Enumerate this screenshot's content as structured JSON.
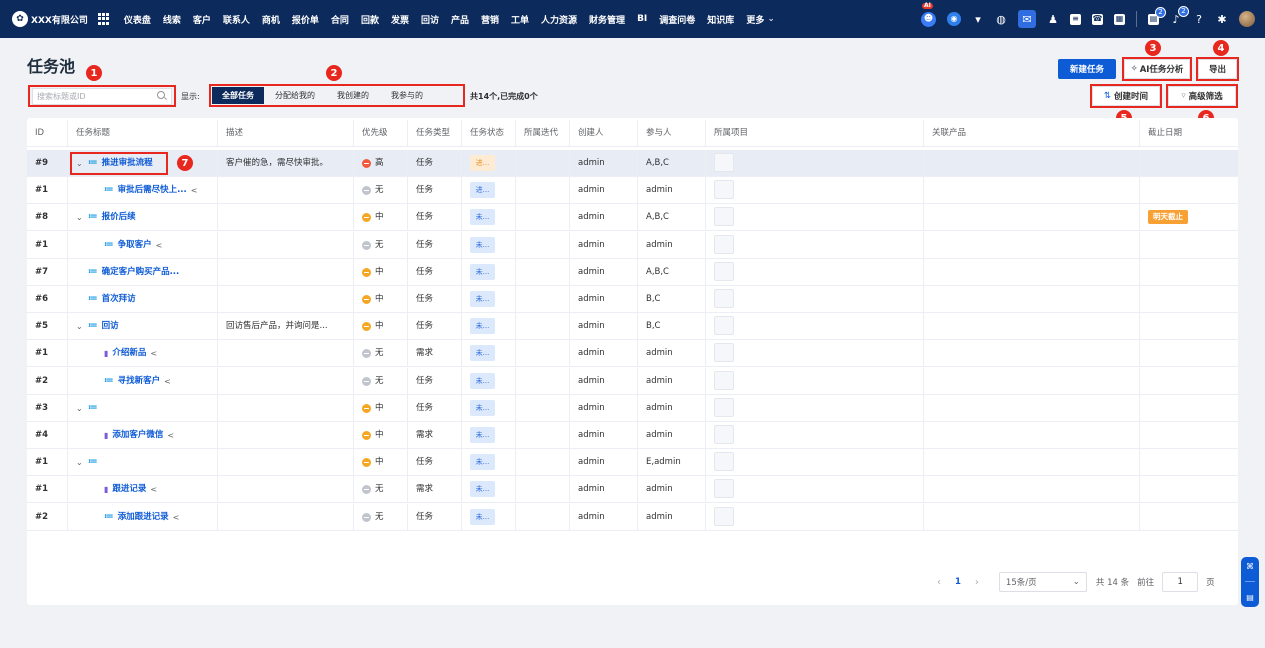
{
  "brand": {
    "name": "XXX有限公司"
  },
  "nav": [
    "仪表盘",
    "线索",
    "客户",
    "联系人",
    "商机",
    "报价单",
    "合同",
    "回款",
    "发票",
    "回访",
    "产品",
    "营销",
    "工单",
    "人力资源",
    "财务管理",
    "BI",
    "调查问卷",
    "知识库",
    "更多"
  ],
  "topbar_icons": {
    "ai_tag": "AI",
    "notify_badge_1": "2",
    "notify_badge_2": "2"
  },
  "page": {
    "title": "任务池"
  },
  "search": {
    "placeholder": "搜索标题或ID"
  },
  "filter": {
    "label": "显示:",
    "tabs": [
      "全部任务",
      "分配给我的",
      "我创建的",
      "我参与的"
    ],
    "active_index": 0,
    "summary": "共14个,已完成0个"
  },
  "actions": {
    "new_task": "新建任务",
    "ai_analysis": "AI任务分析",
    "export": "导出",
    "sort_created": "创建时间",
    "advanced_filter": "高级筛选"
  },
  "markers": [
    "1",
    "2",
    "3",
    "4",
    "5",
    "6",
    "7"
  ],
  "table": {
    "headers": [
      "ID",
      "任务标题",
      "描述",
      "优先级",
      "任务类型",
      "任务状态",
      "所属迭代",
      "创建人",
      "参与人",
      "所属项目",
      "关联产品",
      "截止日期"
    ],
    "rows": [
      {
        "id": "#9",
        "level": 0,
        "expand": true,
        "icon": "list",
        "title": "推进审批流程",
        "share": false,
        "desc": "客户催的急，需尽快审批。",
        "prio": "高",
        "prio_level": "high",
        "type": "任务",
        "status": "进...",
        "status_kind": "ing",
        "creator": "admin",
        "members": "A,B,C",
        "deadline": ""
      },
      {
        "id": "#1",
        "level": 1,
        "expand": false,
        "icon": "list",
        "title": "审批后需尽快上...",
        "share": true,
        "desc": "",
        "prio": "无",
        "prio_level": "none",
        "type": "任务",
        "status": "进...",
        "status_kind": "todo",
        "creator": "admin",
        "members": "admin",
        "deadline": ""
      },
      {
        "id": "#8",
        "level": 0,
        "expand": true,
        "icon": "list",
        "title": "报价后续",
        "share": false,
        "desc": "",
        "prio": "中",
        "prio_level": "mid",
        "type": "任务",
        "status": "未...",
        "status_kind": "todo",
        "creator": "admin",
        "members": "A,B,C",
        "deadline": "明天截止"
      },
      {
        "id": "#1",
        "level": 1,
        "expand": false,
        "icon": "list",
        "title": "争取客户",
        "share": true,
        "desc": "",
        "prio": "无",
        "prio_level": "none",
        "type": "任务",
        "status": "未...",
        "status_kind": "todo",
        "creator": "admin",
        "members": "admin",
        "deadline": ""
      },
      {
        "id": "#7",
        "level": 0,
        "expand": false,
        "icon": "list",
        "title": "确定客户购买产品...",
        "share": false,
        "desc": "",
        "prio": "中",
        "prio_level": "mid",
        "type": "任务",
        "status": "未...",
        "status_kind": "todo",
        "creator": "admin",
        "members": "A,B,C",
        "deadline": ""
      },
      {
        "id": "#6",
        "level": 0,
        "expand": false,
        "icon": "list",
        "title": "首次拜访",
        "share": false,
        "desc": "",
        "prio": "中",
        "prio_level": "mid",
        "type": "任务",
        "status": "未...",
        "status_kind": "todo",
        "creator": "admin",
        "members": "B,C",
        "deadline": ""
      },
      {
        "id": "#5",
        "level": 0,
        "expand": true,
        "icon": "list",
        "title": "回访",
        "share": false,
        "desc": "回访售后产品，并询问是...",
        "prio": "中",
        "prio_level": "mid",
        "type": "任务",
        "status": "未...",
        "status_kind": "todo",
        "creator": "admin",
        "members": "B,C",
        "deadline": ""
      },
      {
        "id": "#1",
        "level": 1,
        "expand": false,
        "icon": "flag",
        "title": "介绍新品",
        "share": true,
        "desc": "",
        "prio": "无",
        "prio_level": "none",
        "type": "需求",
        "status": "未...",
        "status_kind": "todo",
        "creator": "admin",
        "members": "admin",
        "deadline": ""
      },
      {
        "id": "#2",
        "level": 1,
        "expand": false,
        "icon": "list",
        "title": "寻找新客户",
        "share": true,
        "desc": "",
        "prio": "无",
        "prio_level": "none",
        "type": "任务",
        "status": "未...",
        "status_kind": "todo",
        "creator": "admin",
        "members": "admin",
        "deadline": ""
      },
      {
        "id": "#3",
        "level": 0,
        "expand": true,
        "icon": "list",
        "title": "",
        "share": false,
        "desc": "",
        "prio": "中",
        "prio_level": "mid",
        "type": "任务",
        "status": "未...",
        "status_kind": "todo",
        "creator": "admin",
        "members": "admin",
        "deadline": ""
      },
      {
        "id": "#4",
        "level": 1,
        "expand": false,
        "icon": "flag",
        "title": "添加客户微信",
        "share": true,
        "desc": "",
        "prio": "中",
        "prio_level": "mid",
        "type": "需求",
        "status": "未...",
        "status_kind": "todo",
        "creator": "admin",
        "members": "admin",
        "deadline": ""
      },
      {
        "id": "#1",
        "level": 0,
        "expand": true,
        "icon": "list",
        "title": "",
        "share": false,
        "desc": "",
        "prio": "中",
        "prio_level": "mid",
        "type": "任务",
        "status": "未...",
        "status_kind": "todo",
        "creator": "admin",
        "members": "E,admin",
        "deadline": ""
      },
      {
        "id": "#1",
        "level": 1,
        "expand": false,
        "icon": "flag",
        "title": "跟进记录",
        "share": true,
        "desc": "",
        "prio": "无",
        "prio_level": "none",
        "type": "需求",
        "status": "未...",
        "status_kind": "todo",
        "creator": "admin",
        "members": "admin",
        "deadline": ""
      },
      {
        "id": "#2",
        "level": 1,
        "expand": false,
        "icon": "list",
        "title": "添加跟进记录",
        "share": true,
        "desc": "",
        "prio": "无",
        "prio_level": "none",
        "type": "任务",
        "status": "未...",
        "status_kind": "todo",
        "creator": "admin",
        "members": "admin",
        "deadline": ""
      }
    ]
  },
  "pagination": {
    "current": "1",
    "page_size": "15条/页",
    "total": "共 14 条",
    "goto_label": "前往",
    "goto_value": "1",
    "page_unit": "页"
  },
  "colors": {
    "nav_bg": "#0c2a5c",
    "primary": "#0e5bd6",
    "marker": "#e8281e"
  }
}
